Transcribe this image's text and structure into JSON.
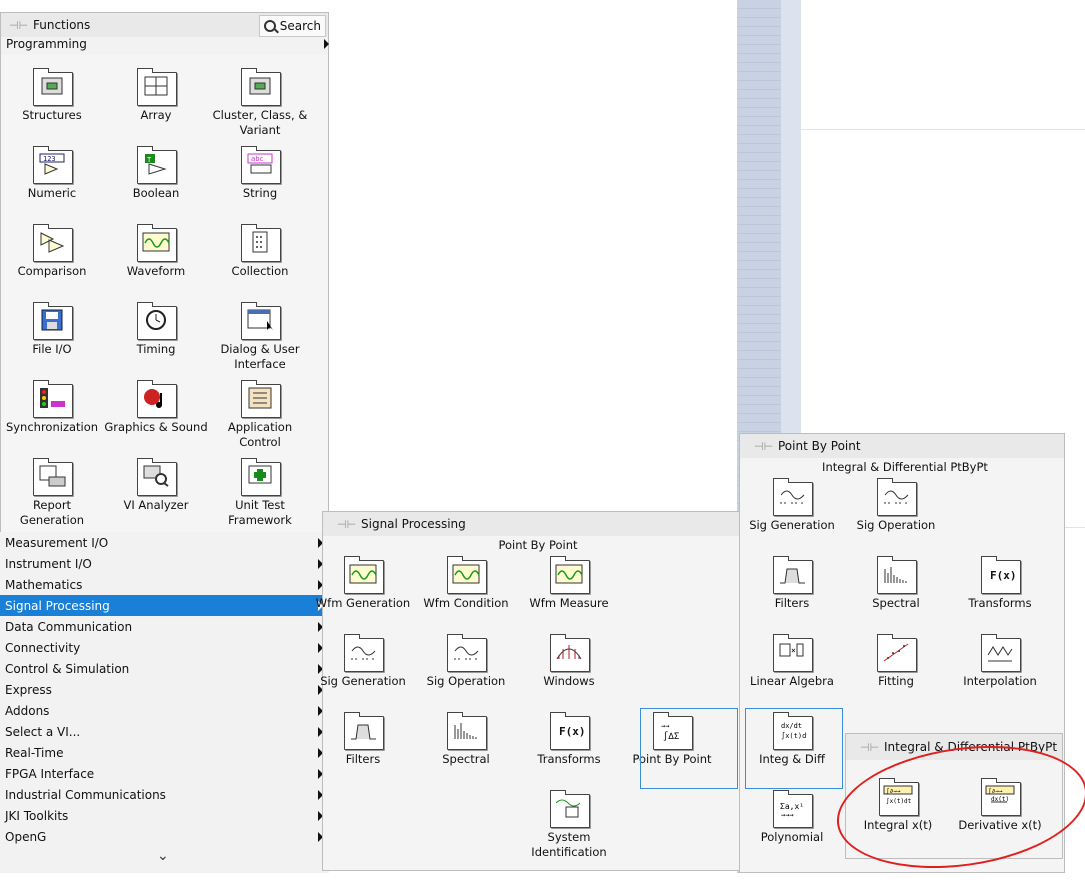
{
  "functions": {
    "title": "Functions",
    "search_label": "Search",
    "category": "Programming",
    "items": [
      {
        "label": "Structures",
        "icon": "structures-icon"
      },
      {
        "label": "Array",
        "icon": "array-icon"
      },
      {
        "label": "Cluster, Class, & Variant",
        "icon": "cluster-icon"
      },
      {
        "label": "Numeric",
        "icon": "numeric-icon"
      },
      {
        "label": "Boolean",
        "icon": "boolean-icon"
      },
      {
        "label": "String",
        "icon": "string-icon"
      },
      {
        "label": "Comparison",
        "icon": "comparison-icon"
      },
      {
        "label": "Waveform",
        "icon": "waveform-icon"
      },
      {
        "label": "Collection",
        "icon": "collection-icon"
      },
      {
        "label": "File I/O",
        "icon": "file-io-icon"
      },
      {
        "label": "Timing",
        "icon": "timing-icon"
      },
      {
        "label": "Dialog & User Interface",
        "icon": "dialog-icon"
      },
      {
        "label": "Synchronization",
        "icon": "synchronization-icon"
      },
      {
        "label": "Graphics & Sound",
        "icon": "graphics-sound-icon"
      },
      {
        "label": "Application Control",
        "icon": "application-control-icon"
      },
      {
        "label": "Report Generation",
        "icon": "report-generation-icon"
      },
      {
        "label": "VI Analyzer",
        "icon": "vi-analyzer-icon"
      },
      {
        "label": "Unit Test Framework",
        "icon": "unit-test-icon"
      }
    ],
    "categories": [
      "Measurement I/O",
      "Instrument I/O",
      "Mathematics",
      "Signal Processing",
      "Data Communication",
      "Connectivity",
      "Control & Simulation",
      "Express",
      "Addons",
      "Select a VI...",
      "Real-Time",
      "FPGA Interface",
      "Industrial Communications",
      "JKI Toolkits",
      "OpenG"
    ],
    "selected_category": "Signal Processing",
    "more_glyph": "⌄"
  },
  "signal_processing": {
    "title": "Signal Processing",
    "subtitle": "Point By Point",
    "items": [
      {
        "label": "Wfm Generation"
      },
      {
        "label": "Wfm Condition"
      },
      {
        "label": "Wfm Measure"
      },
      {
        "label": "Sig Generation"
      },
      {
        "label": "Sig Operation"
      },
      {
        "label": "Windows"
      },
      {
        "label": "Filters"
      },
      {
        "label": "Spectral"
      },
      {
        "label": "Transforms"
      },
      {
        "label": "Point By Point"
      },
      {
        "label": "System Identification"
      }
    ]
  },
  "point_by_point": {
    "title": "Point By Point",
    "subtitle": "Integral & Differential PtByPt",
    "items": [
      {
        "label": "Sig Generation"
      },
      {
        "label": "Sig Operation"
      },
      {
        "label": "Filters"
      },
      {
        "label": "Spectral"
      },
      {
        "label": "Transforms"
      },
      {
        "label": "Linear Algebra"
      },
      {
        "label": "Fitting"
      },
      {
        "label": "Interpolation"
      },
      {
        "label": "Integ & Diff"
      },
      {
        "label": "Polynomial"
      }
    ]
  },
  "integ_diff": {
    "title": "Integral & Differential PtByPt",
    "items": [
      {
        "label": "Integral x(t)"
      },
      {
        "label": "Derivative x(t)"
      }
    ]
  },
  "colors": {
    "selection": "#1a7fd6",
    "highlight": "#3b8fd8",
    "annotation": "#e02020"
  }
}
